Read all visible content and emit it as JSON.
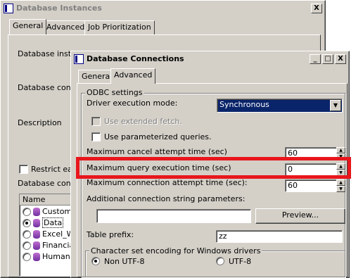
{
  "back_window": {
    "title": "Database Instances",
    "close_label": "X",
    "tabs": [
      "General",
      "Advanced",
      "Job Prioritization"
    ],
    "labels": {
      "instance": "Database instan",
      "connection": "Database conne",
      "description": "Description",
      "restrict": "Restrict eac",
      "connections": "Database conne"
    },
    "list_header": "Name",
    "list_items": [
      "Custome",
      "Data",
      "Excel_W",
      "Financia",
      "Human F"
    ]
  },
  "front_window": {
    "title": "Database Connections",
    "buttons": {
      "minimize": "_",
      "maximize": "□",
      "close": "X"
    },
    "tabs": [
      "General",
      "Advanced"
    ],
    "odbc_group": "ODBC settings",
    "driver_mode_label": "Driver execution mode:",
    "driver_mode_value": "Synchronous",
    "use_extended_fetch": "Use extended fetch.",
    "use_parameterized": "Use parameterized queries.",
    "max_cancel_label": "Maximum cancel attempt time (sec)",
    "max_cancel_value": "60",
    "max_query_label": "Maximum query execution time (sec)",
    "max_query_value": "0",
    "max_connection_label": "Maximum connection attempt time (sec):",
    "max_connection_value": "60",
    "additional_label": "Additional connection string parameters:",
    "additional_value": "",
    "preview_button": "Preview...",
    "table_prefix_label": "Table prefix:",
    "table_prefix_value": "zz",
    "charset_group": "Character set encoding for Windows drivers",
    "charset_options": [
      "Non UTF-8",
      "UTF-8"
    ],
    "charset_selected": "Non UTF-8"
  },
  "highlight_color": "#e8161c"
}
